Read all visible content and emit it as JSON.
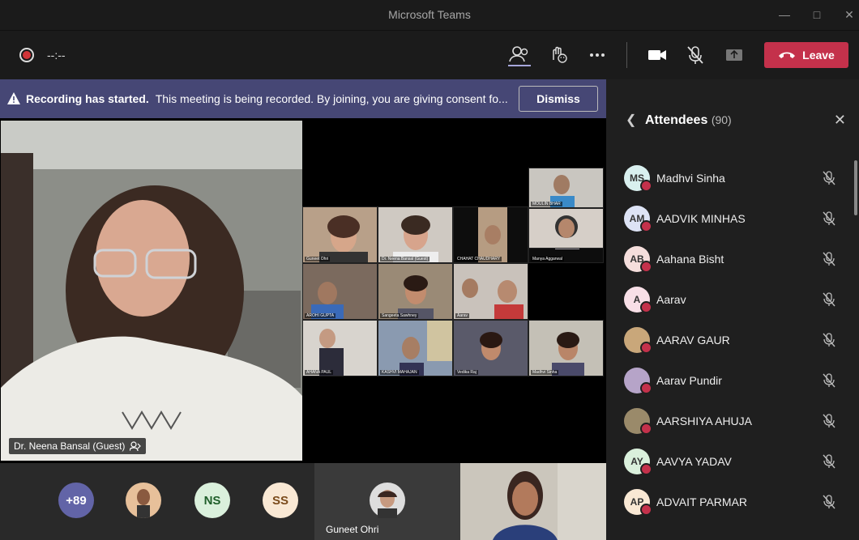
{
  "window": {
    "title": "Microsoft Teams"
  },
  "toolbar": {
    "timer": "--:--",
    "leave_label": "Leave"
  },
  "banner": {
    "bold": "Recording has started.",
    "message": "This meeting is being recorded. By joining, you are giving consent fo...",
    "dismiss_label": "Dismiss"
  },
  "main_video": {
    "name": "Dr. Neena Bansal (Guest)"
  },
  "grid_tiles": [
    {
      "label": "Guneet Ohri"
    },
    {
      "label": "Dr. Neena Bansal (Guest)"
    },
    {
      "label": "CHAHAT CHAUDHARY"
    },
    {
      "label": "Manya Aggarwal"
    },
    {
      "label": "AROHI GUPTA"
    },
    {
      "label": "Sangeeta Sawhney"
    },
    {
      "label": "Aarav"
    },
    {
      "label": "MOULIN BHAR"
    },
    {
      "label": "AHANA PAUL"
    },
    {
      "label": "KASHVI MAHAJAN"
    },
    {
      "label": "Vedika Raj"
    },
    {
      "label": "Madhvi Sinha"
    }
  ],
  "bottom_strip": {
    "overflow_count": "+89",
    "initials_1": "NS",
    "initials_2": "SS",
    "pinned_name": "Guneet Ohri"
  },
  "attendees": {
    "title": "Attendees",
    "count": "(90)",
    "list": [
      {
        "initials": "MS",
        "name": "Madhvi Sinha",
        "color": "#d9f0ef"
      },
      {
        "initials": "AM",
        "name": "AADVIK MINHAS",
        "color": "#dde3f5"
      },
      {
        "initials": "AB",
        "name": "Aahana Bisht",
        "color": "#f5dedc"
      },
      {
        "initials": "A",
        "name": "Aarav",
        "color": "#f8dfe7"
      },
      {
        "initials": "",
        "name": "AARAV GAUR",
        "color": "#c9a77a"
      },
      {
        "initials": "",
        "name": "Aarav Pundir",
        "color": "#b6a4c8"
      },
      {
        "initials": "",
        "name": "AARSHIYA AHUJA",
        "color": "#9a8a6a"
      },
      {
        "initials": "AY",
        "name": "AAVYA YADAV",
        "color": "#daf0dc"
      },
      {
        "initials": "AP",
        "name": "ADVAIT PARMAR",
        "color": "#f9e8d4"
      }
    ]
  },
  "colors": {
    "leave": "#c4314b",
    "banner": "#464775",
    "accent": "#6264a7"
  }
}
